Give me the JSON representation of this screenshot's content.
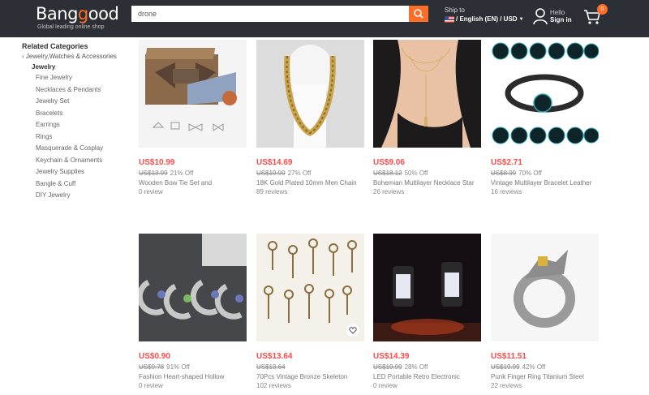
{
  "header": {
    "logo": "Banggood",
    "logo_tagline": "Global leading online shop",
    "search_value": "drone",
    "ship_label": "Ship to",
    "ship_value": "/ English (EN) / USD",
    "hello": "Hello",
    "signin": "Sign in",
    "cart_count": "0",
    "colors": {
      "bar": "#2c2f36",
      "accent": "#ff6e26"
    }
  },
  "sidebar": {
    "title": "Related Categories",
    "parent": "Jewelry,Watches & Accessories",
    "current": "Jewelry",
    "items": [
      "Fine Jewelry",
      "Necklaces & Pendants",
      "Jewelry Set",
      "Bracelets",
      "Earrings",
      "Rings",
      "Masquerade & Cosplay",
      "Keychain & Ornaments",
      "Jewelry Supplies",
      "Bangle & Cuff",
      "DIY Jewelry"
    ]
  },
  "products": [
    {
      "price": "US$10.99",
      "old_price": "US$13.99",
      "off": "21% Off",
      "name": "Wooden Bow Tie Set and",
      "reviews": "0 review",
      "image": "wooden-bow-tie-set"
    },
    {
      "price": "US$14.69",
      "old_price": "US$19.99",
      "off": "27% Off",
      "name": "18K Gold Plated 10mm Men Chain",
      "reviews": "89 reviews",
      "image": "gold-chain-necklace"
    },
    {
      "price": "US$9.06",
      "old_price": "US$18.12",
      "off": "50% Off",
      "name": "Bohemian Multilayer Necklace Star",
      "reviews": "26 reviews",
      "image": "bohemian-necklace"
    },
    {
      "price": "US$2.71",
      "old_price": "US$8.99",
      "off": "70% Off",
      "name": "Vintage Multilayer Bracelet Leather",
      "reviews": "16 reviews",
      "image": "zodiac-bracelet"
    },
    {
      "price": "US$0.90",
      "old_price": "US$9.78",
      "off": "91% Off",
      "name": "Fashion Heart-shaped Hollow",
      "reviews": "0 review",
      "image": "moon-pendants"
    },
    {
      "price": "US$13.64",
      "old_price": "US$13.64",
      "off": "",
      "name": "70Pcs Vintage Bronze Skeleton",
      "reviews": "102 reviews",
      "image": "skeleton-keys"
    },
    {
      "price": "US$14.39",
      "old_price": "US$19.99",
      "off": "28% Off",
      "name": "LED Portable Retro Electronic",
      "reviews": "0 review",
      "image": "led-lanterns"
    },
    {
      "price": "US$11.51",
      "old_price": "US$19.99",
      "off": "42% Off",
      "name": "Punk Finger Ring Titanium Steel",
      "reviews": "22 reviews",
      "image": "punk-ring"
    }
  ]
}
